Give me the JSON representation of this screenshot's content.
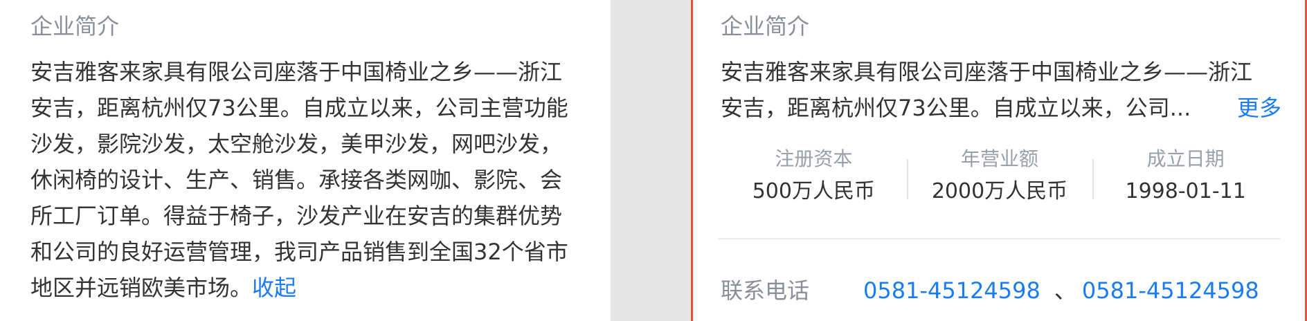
{
  "left": {
    "section_title": "企业简介",
    "lines": [
      "安吉雅客来家具有限公司座落于中国椅业之乡——浙江",
      "安吉，距离杭州仅73公里。自成立以来，公司主营功能",
      "沙发，影院沙发，太空舱沙发，美甲沙发，网吧沙发，",
      "休闲椅的设计、生产、销售。承接各类网咖、影院、会",
      "所工厂订单。得益于椅子，沙发产业在安吉的集群优势",
      "和公司的良好运营管理，我司产品销售到全国32个省市"
    ],
    "last_line": "地区并远销欧美市场。",
    "collapse_label": "收起"
  },
  "right": {
    "section_title": "企业简介",
    "lines": [
      "安吉雅客来家具有限公司座落于中国椅业之乡——浙江",
      "安吉，距离杭州仅73公里。自成立以来，公司..."
    ],
    "more_label": "更多",
    "stats": [
      {
        "label": "注册资本",
        "value": "500万人民币"
      },
      {
        "label": "年营业额",
        "value": "2000万人民币"
      },
      {
        "label": "成立日期",
        "value": "1998-01-11"
      }
    ],
    "contact": {
      "label": "联系电话",
      "phone1": "0581-45124598",
      "separator": "、",
      "phone2": "0581-45124598"
    }
  },
  "colors": {
    "link": "#1a7cf2",
    "highlight_border": "#e8533a",
    "gap_background": "#e6e6e6"
  }
}
